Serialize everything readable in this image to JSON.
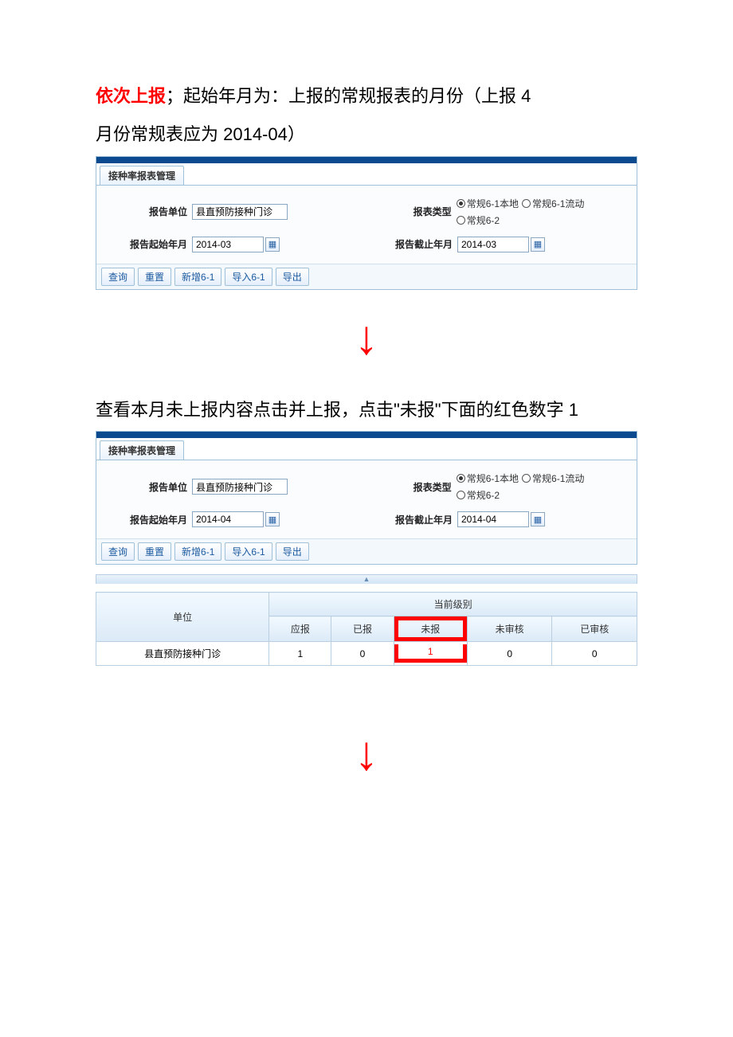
{
  "intro": {
    "title_red": "依次上报",
    "title_colon": "；",
    "title_rest_line1": "起始年月为：上报的常规报表的月份（上报 4",
    "title_rest_line2": "月份常规表应为 2014-04）"
  },
  "panel1": {
    "tab": "接种率报表管理",
    "labels": {
      "unit": "报告单位",
      "type": "报表类型",
      "start": "报告起始年月",
      "end": "报告截止年月"
    },
    "unit_value": "县直预防接种门诊",
    "type_options": [
      "常规6-1本地",
      "常规6-1流动",
      "常规6-2"
    ],
    "type_selected_index": 0,
    "start_value": "2014-03",
    "end_value": "2014-03",
    "buttons": [
      "查询",
      "重置",
      "新增6-1",
      "导入6-1",
      "导出"
    ]
  },
  "mid_text": "查看本月未上报内容点击并上报，点击\"未报\"下面的红色数字 1",
  "panel2": {
    "tab": "接种率报表管理",
    "labels": {
      "unit": "报告单位",
      "type": "报表类型",
      "start": "报告起始年月",
      "end": "报告截止年月"
    },
    "unit_value": "县直预防接种门诊",
    "type_options": [
      "常规6-1本地",
      "常规6-1流动",
      "常规6-2"
    ],
    "type_selected_index": 0,
    "start_value": "2014-04",
    "end_value": "2014-04",
    "buttons": [
      "查询",
      "重置",
      "新增6-1",
      "导入6-1",
      "导出"
    ]
  },
  "table": {
    "group_header": "当前级别",
    "cols": {
      "unit": "单位",
      "due": "应报",
      "done": "已报",
      "missing": "未报",
      "unreviewed": "未审核",
      "reviewed": "已审核"
    },
    "rows": [
      {
        "unit": "县直预防接种门诊",
        "due": "1",
        "done": "0",
        "missing": "1",
        "unreviewed": "0",
        "reviewed": "0"
      }
    ]
  },
  "arrow": "↓"
}
